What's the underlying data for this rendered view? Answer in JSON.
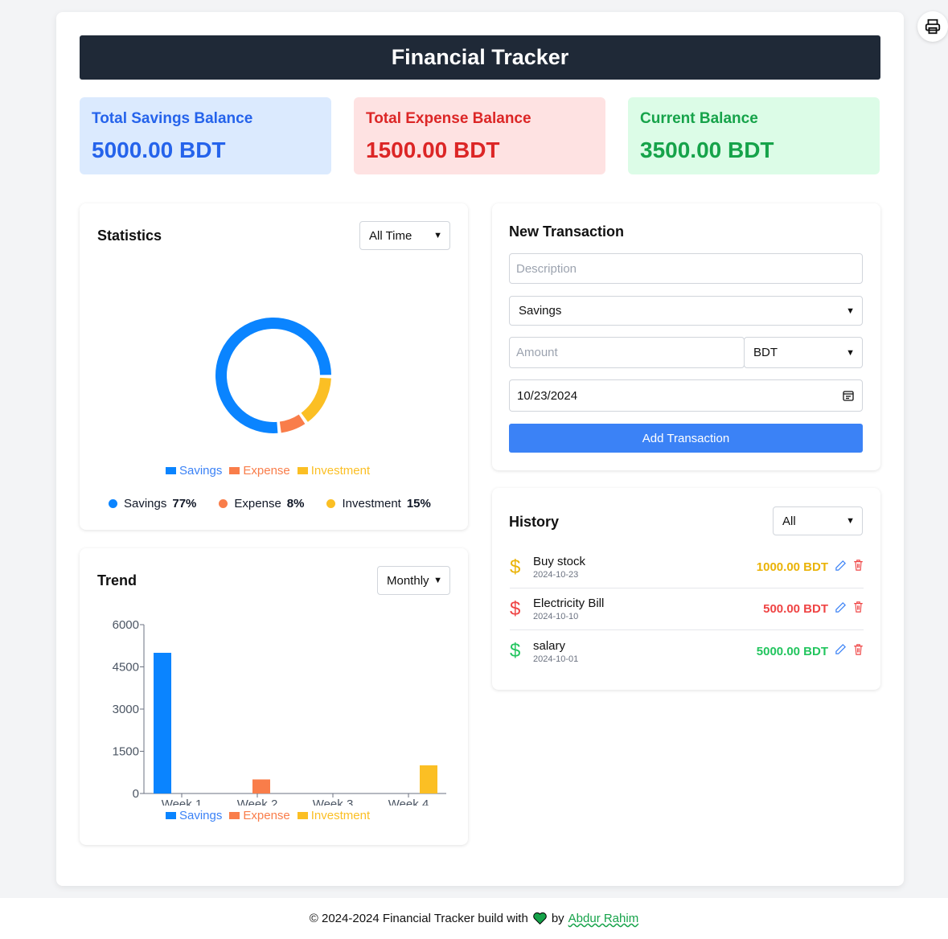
{
  "header": {
    "title": "Financial Tracker"
  },
  "cards": [
    {
      "label": "Total Savings Balance",
      "value": "5000.00 BDT",
      "bg": "#dbeafe",
      "color": "#2563eb"
    },
    {
      "label": "Total Expense Balance",
      "value": "1500.00 BDT",
      "bg": "#fee2e2",
      "color": "#dc2626"
    },
    {
      "label": "Current Balance",
      "value": "3500.00 BDT",
      "bg": "#dcfce7",
      "color": "#16a34a"
    }
  ],
  "statistics": {
    "title": "Statistics",
    "filter": "All Time",
    "legend": [
      "Savings",
      "Expense",
      "Investment"
    ],
    "percentages": [
      {
        "label": "Savings",
        "value": "77%"
      },
      {
        "label": "Expense",
        "value": "8%"
      },
      {
        "label": "Investment",
        "value": "15%"
      }
    ]
  },
  "trend": {
    "title": "Trend",
    "filter": "Monthly",
    "legend": [
      "Savings",
      "Expense",
      "Investment"
    ]
  },
  "new_transaction": {
    "title": "New Transaction",
    "description_placeholder": "Description",
    "type": "Savings",
    "amount_placeholder": "Amount",
    "currency": "BDT",
    "date": "10/23/2024",
    "submit_label": "Add Transaction"
  },
  "history": {
    "title": "History",
    "filter": "All",
    "items": [
      {
        "description": "Buy stock",
        "date": "2024-10-23",
        "amount": "1000.00 BDT",
        "color": "#eab308"
      },
      {
        "description": "Electricity Bill",
        "date": "2024-10-10",
        "amount": "500.00 BDT",
        "color": "#ef4444"
      },
      {
        "description": "salary",
        "date": "2024-10-01",
        "amount": "5000.00 BDT",
        "color": "#22c55e"
      }
    ]
  },
  "footer": {
    "text": "© 2024-2024 Financial Tracker build with",
    "by": "by",
    "author": "Abdur Rahim"
  },
  "colors": {
    "savings": "#0a84ff",
    "expense": "#f97d4a",
    "investment": "#fbbf24"
  },
  "chart_data": [
    {
      "type": "pie",
      "categories": [
        "Savings",
        "Expense",
        "Investment"
      ],
      "values": [
        77,
        8,
        15
      ],
      "title": "",
      "variant": "donut",
      "legend": "bottom"
    },
    {
      "type": "bar",
      "categories": [
        "Week 1",
        "Week 2",
        "Week 3",
        "Week 4"
      ],
      "series": [
        {
          "name": "Savings",
          "values": [
            5000,
            0,
            0,
            0
          ]
        },
        {
          "name": "Expense",
          "values": [
            0,
            500,
            0,
            0
          ]
        },
        {
          "name": "Investment",
          "values": [
            0,
            0,
            0,
            1000
          ]
        }
      ],
      "yticks": [
        0,
        1500,
        3000,
        4500,
        6000
      ],
      "ylim": [
        0,
        6000
      ],
      "xlabel": "",
      "ylabel": "",
      "legend": "bottom"
    }
  ]
}
